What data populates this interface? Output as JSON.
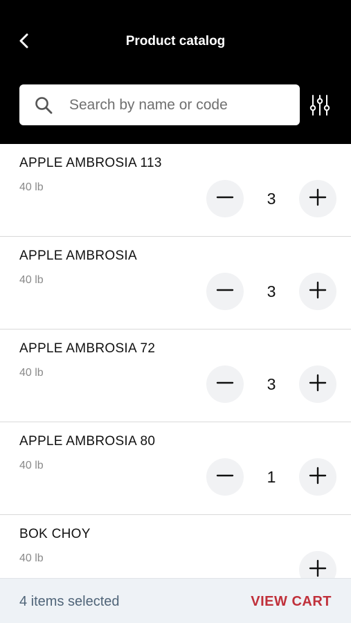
{
  "header": {
    "title": "Product catalog",
    "back_icon": "chevron-left-icon",
    "filter_icon": "sliders-icon"
  },
  "search": {
    "placeholder": "Search by name or code",
    "value": "",
    "icon": "search-icon"
  },
  "products": [
    {
      "name": "APPLE AMBROSIA 113",
      "size": "40 lb",
      "quantity": "3"
    },
    {
      "name": "APPLE AMBROSIA",
      "size": "40 lb",
      "quantity": "3"
    },
    {
      "name": "APPLE AMBROSIA 72",
      "size": "40 lb",
      "quantity": "3"
    },
    {
      "name": "APPLE AMBROSIA 80",
      "size": "40 lb",
      "quantity": "1"
    },
    {
      "name": "BOK CHOY",
      "size": "40 lb",
      "quantity": ""
    }
  ],
  "footer": {
    "selected_text": "4 items selected",
    "cart_label": "VIEW CART"
  },
  "colors": {
    "header_bg": "#000000",
    "accent": "#c0303a",
    "footer_bg": "#eef2f6",
    "stepper_bg": "#f1f2f4"
  }
}
